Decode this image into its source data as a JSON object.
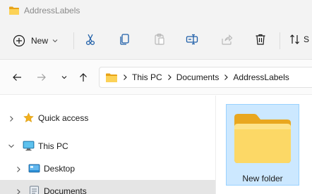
{
  "window": {
    "title": "AddressLabels"
  },
  "commandbar": {
    "new_label": "New",
    "sort_label": "S",
    "icons": [
      "cut-icon",
      "copy-icon",
      "paste-icon",
      "rename-icon",
      "share-icon",
      "delete-icon",
      "sort-icon"
    ]
  },
  "navigation": {
    "back_icon": "arrow-left-icon",
    "forward_icon": "arrow-right-icon",
    "recent_icon": "chevron-down-icon",
    "up_icon": "arrow-up-icon"
  },
  "address": {
    "crumbs": [
      "This PC",
      "Documents",
      "AddressLabels"
    ]
  },
  "tree": {
    "items": [
      {
        "label": "Quick access",
        "icon": "star-icon"
      },
      {
        "label": "This PC",
        "icon": "monitor-icon"
      },
      {
        "label": "Desktop",
        "icon": "desktop-icon"
      },
      {
        "label": "Documents",
        "icon": "documents-icon"
      }
    ]
  },
  "content": {
    "items": [
      {
        "label": "New folder",
        "icon": "folder-icon",
        "selected": true
      }
    ]
  },
  "colors": {
    "folder": "#f8c53a",
    "folder_light": "#fcdc6e",
    "selection_bg": "#cce8ff",
    "selection_border": "#99d1ff",
    "accent": "#0067c0",
    "star": "#f2b01e"
  }
}
